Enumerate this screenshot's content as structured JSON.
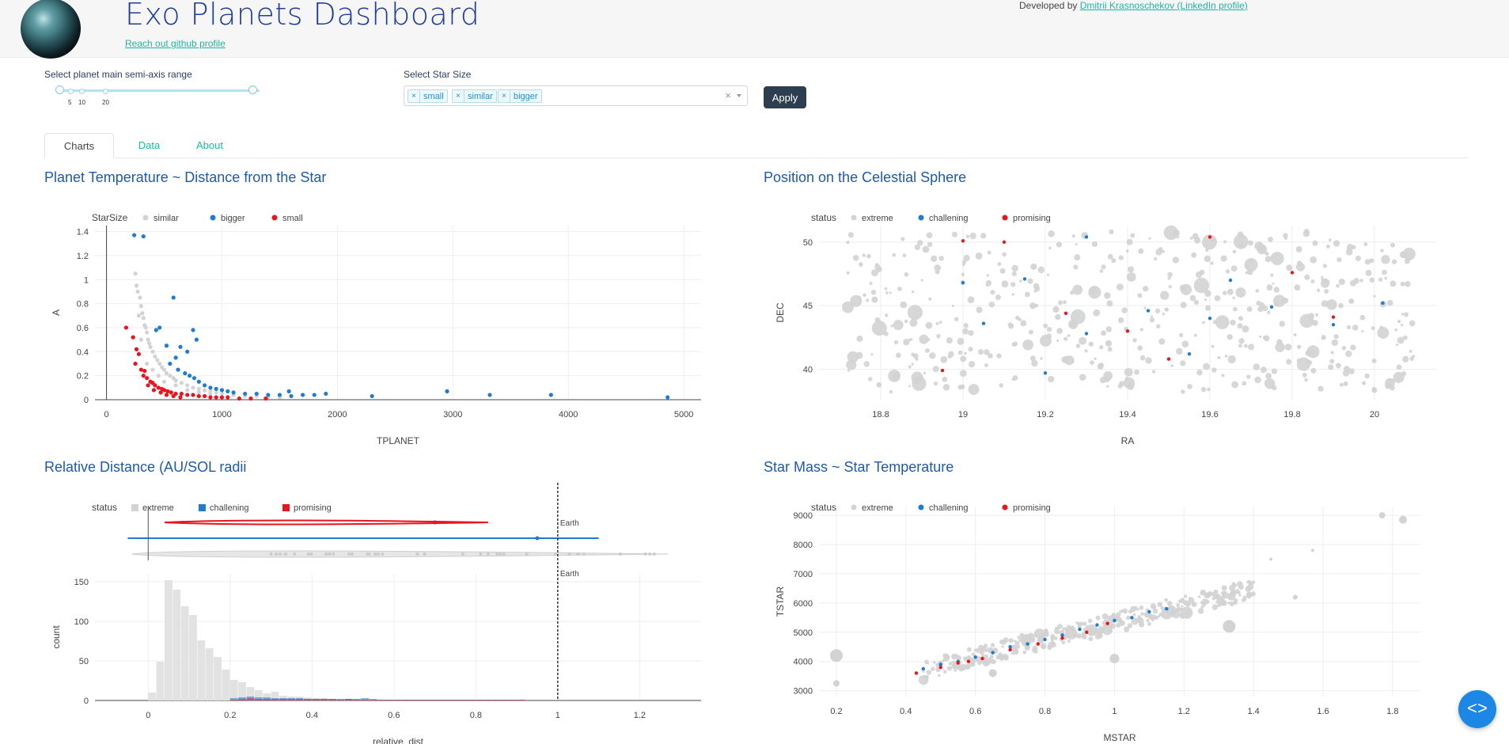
{
  "header": {
    "title": "Exo Planets Dashboard",
    "github_link": "Reach out github profile",
    "developer_prefix": "Developed by ",
    "developer_link": "Dmitrii Krasnoschekov (LinkedIn profile)"
  },
  "controls": {
    "range_label": "Select planet main semi-axis range",
    "range_marks": [
      "5",
      "10",
      "20"
    ],
    "star_size_label": "Select Star Size",
    "star_sizes": [
      "small",
      "similar",
      "bigger"
    ],
    "apply_label": "Apply"
  },
  "tabs": [
    "Charts",
    "Data",
    "About"
  ],
  "colors": {
    "grey": "#d3d3d3",
    "blue": "#1f7bd4",
    "red": "#e8141e",
    "title": "#1f5aa8"
  },
  "chart_data": [
    {
      "type": "scatter",
      "title": "Planet Temperature ~ Distance from the Star",
      "xlabel": "TPLANET",
      "ylabel": "A",
      "xlim": [
        -100,
        5150
      ],
      "ylim": [
        0,
        1.45
      ],
      "x_ticks": [
        "0",
        "1000",
        "2000",
        "3000",
        "4000",
        "5000"
      ],
      "y_ticks": [
        "0",
        "0.2",
        "0.4",
        "0.6",
        "0.8",
        "1",
        "1.2",
        "1.4"
      ],
      "legend_title": "StarSize",
      "series": [
        {
          "name": "similar",
          "color": "#d3d3d3",
          "points": [
            [
              250,
              1.05
            ],
            [
              260,
              0.95
            ],
            [
              270,
              0.9
            ],
            [
              290,
              0.85
            ],
            [
              300,
              0.78
            ],
            [
              310,
              0.72
            ],
            [
              320,
              0.68
            ],
            [
              330,
              0.62
            ],
            [
              340,
              0.6
            ],
            [
              350,
              0.56
            ],
            [
              360,
              0.5
            ],
            [
              370,
              0.47
            ],
            [
              380,
              0.44
            ],
            [
              400,
              0.4
            ],
            [
              420,
              0.36
            ],
            [
              440,
              0.33
            ],
            [
              460,
              0.3
            ],
            [
              480,
              0.27
            ],
            [
              500,
              0.25
            ],
            [
              520,
              0.22
            ],
            [
              550,
              0.2
            ],
            [
              580,
              0.18
            ],
            [
              600,
              0.16
            ],
            [
              650,
              0.14
            ],
            [
              700,
              0.12
            ],
            [
              750,
              0.1
            ],
            [
              800,
              0.09
            ],
            [
              850,
              0.08
            ],
            [
              900,
              0.07
            ],
            [
              950,
              0.06
            ],
            [
              1000,
              0.05
            ],
            [
              1100,
              0.04
            ],
            [
              1200,
              0.03
            ],
            [
              1300,
              0.03
            ],
            [
              1400,
              0.02
            ],
            [
              1500,
              0.02
            ],
            [
              280,
              0.7
            ],
            [
              300,
              0.5
            ],
            [
              350,
              0.3
            ],
            [
              400,
              0.25
            ],
            [
              450,
              0.2
            ],
            [
              500,
              0.15
            ],
            [
              600,
              0.12
            ],
            [
              700,
              0.08
            ],
            [
              800,
              0.06
            ],
            [
              900,
              0.05
            ]
          ]
        },
        {
          "name": "bigger",
          "color": "#1f7bd4",
          "points": [
            [
              240,
              1.37
            ],
            [
              320,
              1.36
            ],
            [
              580,
              0.85
            ],
            [
              460,
              0.6
            ],
            [
              430,
              0.58
            ],
            [
              750,
              0.58
            ],
            [
              780,
              0.5
            ],
            [
              520,
              0.45
            ],
            [
              640,
              0.44
            ],
            [
              700,
              0.4
            ],
            [
              600,
              0.35
            ],
            [
              550,
              0.3
            ],
            [
              620,
              0.25
            ],
            [
              680,
              0.22
            ],
            [
              720,
              0.2
            ],
            [
              760,
              0.18
            ],
            [
              800,
              0.15
            ],
            [
              850,
              0.12
            ],
            [
              900,
              0.1
            ],
            [
              950,
              0.09
            ],
            [
              1000,
              0.08
            ],
            [
              1050,
              0.07
            ],
            [
              1100,
              0.06
            ],
            [
              1200,
              0.05
            ],
            [
              1300,
              0.05
            ],
            [
              1400,
              0.04
            ],
            [
              1500,
              0.04
            ],
            [
              1580,
              0.07
            ],
            [
              1600,
              0.03
            ],
            [
              1700,
              0.04
            ],
            [
              1800,
              0.04
            ],
            [
              1900,
              0.05
            ],
            [
              2300,
              0.03
            ],
            [
              2950,
              0.07
            ],
            [
              3320,
              0.04
            ],
            [
              3850,
              0.04
            ],
            [
              4860,
              0.02
            ]
          ]
        },
        {
          "name": "small",
          "color": "#e8141e",
          "points": [
            [
              170,
              0.6
            ],
            [
              230,
              0.52
            ],
            [
              260,
              0.42
            ],
            [
              280,
              0.38
            ],
            [
              250,
              0.3
            ],
            [
              300,
              0.25
            ],
            [
              320,
              0.2
            ],
            [
              350,
              0.18
            ],
            [
              380,
              0.15
            ],
            [
              400,
              0.14
            ],
            [
              420,
              0.12
            ],
            [
              450,
              0.1
            ],
            [
              480,
              0.09
            ],
            [
              500,
              0.08
            ],
            [
              530,
              0.07
            ],
            [
              560,
              0.06
            ],
            [
              600,
              0.05
            ],
            [
              650,
              0.05
            ],
            [
              700,
              0.04
            ],
            [
              750,
              0.04
            ],
            [
              800,
              0.03
            ],
            [
              850,
              0.03
            ],
            [
              900,
              0.02
            ],
            [
              950,
              0.02
            ],
            [
              1000,
              0.02
            ],
            [
              1050,
              0.02
            ],
            [
              1150,
              0.01
            ],
            [
              1250,
              0.01
            ],
            [
              1380,
              0.01
            ],
            [
              330,
              0.24
            ],
            [
              360,
              0.12
            ],
            [
              410,
              0.08
            ],
            [
              470,
              0.06
            ],
            [
              520,
              0.04
            ],
            [
              580,
              0.03
            ],
            [
              640,
              0.02
            ]
          ]
        }
      ]
    },
    {
      "type": "scatter",
      "title": "Position on the Celestial Sphere",
      "xlabel": "RA",
      "ylabel": "DEC",
      "xlim": [
        18.65,
        20.15
      ],
      "ylim": [
        37.6,
        51.3
      ],
      "x_ticks": [
        "18.8",
        "19",
        "19.2",
        "19.4",
        "19.6",
        "19.8",
        "20"
      ],
      "y_ticks": [
        "40",
        "45",
        "50"
      ],
      "legend_title": "status",
      "series": [
        {
          "name": "extreme",
          "color": "#d3d3d3",
          "points": "dense cloud 18.7–20.1 RA, 38–51 DEC"
        },
        {
          "name": "challening",
          "color": "#1f7bd4",
          "points": [
            [
              19.0,
              46.8
            ],
            [
              19.15,
              47.1
            ],
            [
              19.3,
              42.8
            ],
            [
              19.45,
              44.6
            ],
            [
              19.55,
              41.2
            ],
            [
              19.65,
              47.0
            ],
            [
              19.75,
              44.9
            ],
            [
              19.9,
              43.5
            ],
            [
              19.3,
              50.4
            ],
            [
              19.05,
              43.6
            ],
            [
              19.2,
              39.7
            ],
            [
              20.02,
              45.2
            ],
            [
              19.6,
              44.0
            ]
          ]
        },
        {
          "name": "promising",
          "color": "#e8141e",
          "points": [
            [
              19.0,
              50.1
            ],
            [
              19.1,
              50.0
            ],
            [
              18.95,
              39.9
            ],
            [
              19.25,
              44.4
            ],
            [
              19.5,
              40.8
            ],
            [
              19.6,
              50.4
            ],
            [
              19.8,
              47.6
            ],
            [
              19.9,
              44.1
            ],
            [
              19.4,
              43.0
            ]
          ]
        }
      ]
    },
    {
      "type": "histogram",
      "title": "Relative Distance (AU/SOL radii",
      "xlabel": "relative_dist",
      "ylabel": "count",
      "xlim": [
        -0.13,
        1.35
      ],
      "ylim": [
        0,
        160
      ],
      "x_ticks": [
        "0",
        "0.2",
        "0.4",
        "0.6",
        "0.8",
        "1",
        "1.2"
      ],
      "y_ticks": [
        "0",
        "50",
        "100",
        "150"
      ],
      "legend_title": "status",
      "legend": [
        "extreme",
        "challening",
        "promising"
      ],
      "annotation": "Earth",
      "annotation_x": 1,
      "bin_width": 0.02,
      "extreme_counts": [
        0,
        0,
        0,
        0,
        0,
        0,
        0,
        0,
        10,
        49,
        152,
        140,
        119,
        108,
        76,
        66,
        55,
        39,
        26,
        23,
        17,
        13,
        9,
        11,
        6,
        5,
        5,
        4,
        3,
        3,
        2,
        2,
        2,
        2,
        2,
        1,
        1,
        1,
        1,
        1,
        1,
        1,
        1,
        1,
        1,
        1,
        1,
        1,
        1,
        1,
        1,
        1,
        1,
        1
      ],
      "challening_counts": [
        0,
        0,
        0,
        0,
        0,
        0,
        0,
        0,
        0,
        0,
        0,
        0,
        0,
        0,
        0,
        0,
        0,
        0,
        3,
        4,
        5,
        4,
        4,
        3,
        3,
        3,
        3,
        2,
        2,
        2,
        2,
        2,
        2,
        2,
        3,
        2,
        1,
        1,
        1,
        1,
        1,
        1,
        1,
        1,
        1,
        1,
        1,
        1,
        1,
        1,
        1,
        1,
        1,
        1
      ],
      "promising_counts": [
        0,
        0,
        0,
        0,
        0,
        0,
        0,
        0,
        0,
        0,
        0,
        0,
        0,
        0,
        0,
        0,
        0,
        0,
        1,
        2,
        3,
        2,
        2,
        2,
        2,
        2,
        2,
        2,
        2,
        2,
        2,
        1,
        2,
        1,
        1,
        1,
        1,
        1,
        1,
        1,
        1,
        1,
        1,
        1,
        1,
        1,
        1,
        1,
        1,
        1,
        1,
        1,
        1,
        1
      ]
    },
    {
      "type": "scatter",
      "title": "Star Mass ~ Star Temperature",
      "xlabel": "MSTAR",
      "ylabel": "TSTAR",
      "xlim": [
        0.15,
        1.88
      ],
      "ylim": [
        2800,
        9300
      ],
      "x_ticks": [
        "0.2",
        "0.4",
        "0.6",
        "0.8",
        "1",
        "1.2",
        "1.4",
        "1.6",
        "1.8"
      ],
      "y_ticks": [
        "3000",
        "4000",
        "5000",
        "6000",
        "7000",
        "8000",
        "9000"
      ],
      "legend_title": "status",
      "series": [
        {
          "name": "extreme",
          "color": "#d3d3d3",
          "points": "trend from (0.45,3700) to (1.4,6500); outliers (0.2,4200),(0.2,3250),(1.77,9000),(1.83,8850),(1.57,7800),(1.45,7500),(1.52,6200)"
        },
        {
          "name": "challening",
          "color": "#1f7bd4",
          "points": [
            [
              0.45,
              3750
            ],
            [
              0.5,
              3900
            ],
            [
              0.55,
              4000
            ],
            [
              0.6,
              4150
            ],
            [
              0.65,
              4300
            ],
            [
              0.7,
              4500
            ],
            [
              0.75,
              4600
            ],
            [
              0.8,
              4750
            ],
            [
              0.85,
              4900
            ],
            [
              0.9,
              5100
            ],
            [
              0.95,
              5250
            ],
            [
              1.0,
              5400
            ],
            [
              1.05,
              5500
            ],
            [
              1.1,
              5700
            ],
            [
              1.15,
              5800
            ]
          ]
        },
        {
          "name": "promising",
          "color": "#e8141e",
          "points": [
            [
              0.43,
              3600
            ],
            [
              0.5,
              3800
            ],
            [
              0.55,
              3950
            ],
            [
              0.58,
              4000
            ],
            [
              0.62,
              4100
            ],
            [
              0.7,
              4400
            ],
            [
              0.78,
              4600
            ],
            [
              0.85,
              4800
            ],
            [
              0.92,
              5000
            ],
            [
              0.98,
              5300
            ]
          ]
        }
      ]
    }
  ]
}
